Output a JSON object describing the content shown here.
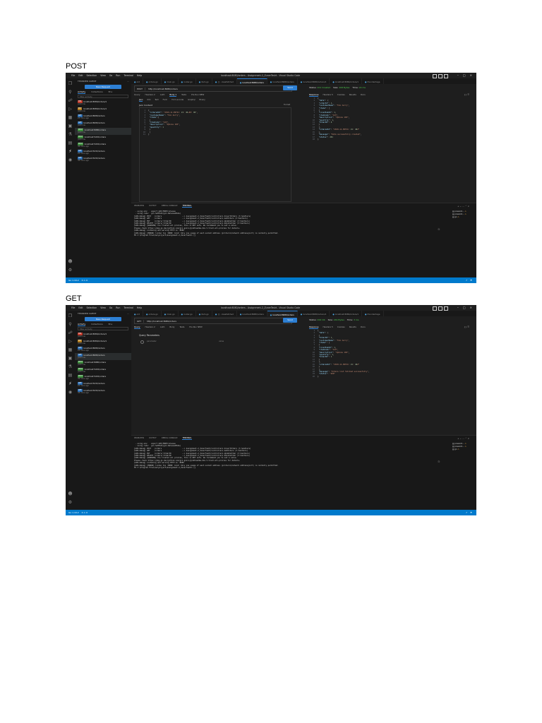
{
  "sections": [
    {
      "label": "POST",
      "titlebar": {
        "menus": [
          "File",
          "Edit",
          "Selection",
          "View",
          "Go",
          "Run",
          "Terminal",
          "Help"
        ],
        "title": "localhost:8080/orders - Assignment-2_ZunerTesht - Visual Studio Code"
      },
      "sidebar": {
        "header": "THUNDER CLIENT",
        "new_request": "New Request",
        "tabs": [
          "Activity",
          "Collections",
          "Env"
        ],
        "filter_placeholder": "filter activity",
        "history": [
          {
            "method": "DEL",
            "url": "localhost:8080/orders/1",
            "ago": "just now"
          },
          {
            "method": "PUT",
            "url": "localhost:8080/orders/1",
            "ago": "just now"
          },
          {
            "method": "GET",
            "url": "localhost:8080/orders",
            "ago": "23 mins ago"
          },
          {
            "method": "GET",
            "url": "localhost:8080/orders",
            "ago": "just now"
          },
          {
            "method": "POST",
            "url": "localhost:8080/orders",
            "ago": "just now",
            "selected": true
          },
          {
            "method": "POST",
            "url": "localhost:5432/orders",
            "ago": "just now"
          },
          {
            "method": "POST",
            "url": "localhost:5432/orders",
            "ago": "36 mins ago"
          },
          {
            "method": "GET",
            "url": "localhost:5432/orders",
            "ago": "24 mins ago"
          },
          {
            "method": "GET",
            "url": "localhost:5432/orders",
            "ago": "38 mins ago"
          }
        ]
      },
      "tabs": [
        {
          "label": "ord",
          "active": false
        },
        {
          "label": "orders.go",
          "active": false
        },
        {
          "label": "main.go",
          "active": false
        },
        {
          "label": "router.go",
          "active": false
        },
        {
          "label": "item.go",
          "active": false
        },
        {
          "label": "{} .rowsfetched",
          "active": false
        },
        {
          "label": "localhost:8080/orders",
          "active": true
        },
        {
          "label": "localhost:8080/orders",
          "active": false
        },
        {
          "label": "localhost:8080/orders/1",
          "active": false
        },
        {
          "label": "localhost:8080/orders/1",
          "active": false
        },
        {
          "label": "thunderdage",
          "active": false
        }
      ],
      "request": {
        "method": "POST",
        "url": "http://localhost:8080/orders",
        "send": "Send",
        "tabs": [
          "Query",
          "Headers 2",
          "Auth",
          "Body 1",
          "Tests",
          "Pre Run NEW"
        ],
        "active_tab": "Body 1",
        "body_tabs": [
          "Json",
          "Xml",
          "Text",
          "Form",
          "Form-encode",
          "Graphql",
          "Binary"
        ],
        "active_body_tab": "Json",
        "json_label": "Json Content",
        "format": "Format",
        "code": [
          {
            "n": "1",
            "t": "{"
          },
          {
            "n": "2",
            "t": "  \"orderedAt\":\"2019-11-09T21:21:46+00:00\","
          },
          {
            "n": "3",
            "t": "  \"customerName\":\"Tom Jerry\","
          },
          {
            "n": "4",
            "t": "  \"items\":["
          },
          {
            "n": "5",
            "t": "    {"
          },
          {
            "n": "6",
            "t": "      \"itemCode\":\"123\","
          },
          {
            "n": "7",
            "t": "      \"description\":\"Iphone 10X\","
          },
          {
            "n": "8",
            "t": "      \"quantity\":1"
          },
          {
            "n": "9",
            "t": "    }"
          },
          {
            "n": "10",
            "t": "  ]"
          },
          {
            "n": "11",
            "t": "}"
          }
        ]
      },
      "response": {
        "status_label": "Status:",
        "status": "201 Created",
        "size_label": "Size:",
        "size": "208 Bytes",
        "time_label": "Time:",
        "time": "22 ms",
        "tabs": [
          "Response",
          "Headers 5",
          "Cookies",
          "Results",
          "Docs"
        ],
        "code": [
          {
            "n": "1",
            "t": "{"
          },
          {
            "n": "2",
            "t": "  \"data\": {"
          },
          {
            "n": "3",
            "t": "    \"orderId\": 1,"
          },
          {
            "n": "4",
            "t": "    \"customerName\": \"Tom Jerry\","
          },
          {
            "n": "5",
            "t": "    \"items\": ["
          },
          {
            "n": "6",
            "t": "      {"
          },
          {
            "n": "7",
            "t": "        \"lineItemId\": 1,"
          },
          {
            "n": "8",
            "t": "        \"itemCode\": \"123\","
          },
          {
            "n": "9",
            "t": "        \"description\": \"Iphone 10X\","
          },
          {
            "n": "10",
            "t": "        \"quantity\": 1,"
          },
          {
            "n": "11",
            "t": "        \"OrderID\": 0"
          },
          {
            "n": "12",
            "t": "      }"
          },
          {
            "n": "13",
            "t": "    ],"
          },
          {
            "n": "14",
            "t": "    \"orderedAt\": \"2019-11-09T21:21:46Z\""
          },
          {
            "n": "15",
            "t": "  },"
          },
          {
            "n": "16",
            "t": "  \"message\": \"Data successfully created\","
          },
          {
            "n": "17",
            "t": "  \"status\": 201"
          },
          {
            "n": "18",
            "t": "}"
          }
        ]
      },
      "panel": {
        "tabs": [
          "PROBLEMS",
          "OUTPUT",
          "DEBUG CONSOLE",
          "TERMINAL"
        ],
        "active": "TERMINAL",
        "terminal": [
          " - using env:   export GIN_MODE=release",
          " - using code:  gin.SetMode(gin.ReleaseMode)",
          "",
          "[GIN-debug] POST   /orders                   --> Assignment-2_ZunerTesht/controllers.InsertOrders (3 handlers)",
          "[GIN-debug] GET    /orders                   --> Assignment-2_ZunerTesht/controllers.GetOrders (3 handlers)",
          "[GIN-debug] PUT    /orders/:OrderID          --> Assignment-2_ZunerTesht/controllers.UpdateOrder (3 handlers)",
          "[GIN-debug] DELETE /orders/:OrderID          --> Assignment-2_ZunerTesht/controllers.DeleteOrder (3 handlers)",
          "[GIN-debug] [WARNING] You trusted all proxies, this is NOT safe. We recommend you to set a value.",
          "Please check https://pkg.go.dev/github.com/gin-gonic/gin#readme-don-t-trust-all-proxies for details.",
          "[GIN-debug] Listening and serving HTTP on :8080",
          "[GIN-debug] [ERROR] listen tcp :8080: bind: Only one usage of each socket address (protocol/network address/port) is normally permitted.",
          "PS C:\\Program Files\\Go\\project\\Assignment-2_ZunerTesht> []"
        ],
        "terminals": [
          "powersh...",
          "powersh...",
          "go"
        ]
      },
      "statusbar": {
        "left": [
          "Go 1.19.2",
          "0 ⚠ 0"
        ],
        "right": [
          "↗",
          "⚑"
        ]
      }
    },
    {
      "label": "GET",
      "titlebar": {
        "menus": [
          "File",
          "Edit",
          "Selection",
          "View",
          "Go",
          "Run",
          "Terminal",
          "Help"
        ],
        "title": "localhost:8080/orders - Assignment-2_ZunerTesht - Visual Studio Code"
      },
      "sidebar": {
        "header": "THUNDER CLIENT",
        "new_request": "New Request",
        "tabs": [
          "Activity",
          "Collections",
          "Env"
        ],
        "filter_placeholder": "filter activity",
        "history": [
          {
            "method": "DEL",
            "url": "localhost:8080/orders/1",
            "ago": "just now"
          },
          {
            "method": "PUT",
            "url": "localhost:8080/orders/1",
            "ago": "just now"
          },
          {
            "method": "GET",
            "url": "localhost:8080/orders",
            "ago": "23 mins ago"
          },
          {
            "method": "GET",
            "url": "localhost:8080/orders",
            "ago": "just now",
            "selected": true
          },
          {
            "method": "POST",
            "url": "localhost:8080/orders",
            "ago": "just now"
          },
          {
            "method": "POST",
            "url": "localhost:5432/orders",
            "ago": "just now"
          },
          {
            "method": "POST",
            "url": "localhost:5432/orders",
            "ago": "36 mins ago"
          },
          {
            "method": "GET",
            "url": "localhost:5432/orders",
            "ago": "24 mins ago"
          },
          {
            "method": "GET",
            "url": "localhost:5432/orders",
            "ago": "38 mins ago"
          }
        ]
      },
      "tabs": [
        {
          "label": "ord",
          "active": false
        },
        {
          "label": "orders.go",
          "active": false
        },
        {
          "label": "main.go",
          "active": false
        },
        {
          "label": "router.go",
          "active": false
        },
        {
          "label": "item.go",
          "active": false
        },
        {
          "label": "{} .rowsfetched",
          "active": false
        },
        {
          "label": "localhost:8080/orders",
          "active": false
        },
        {
          "label": "localhost:8080/orders",
          "active": true
        },
        {
          "label": "localhost:8080/orders/1",
          "active": false
        },
        {
          "label": "localhost:8080/orders/1",
          "active": false
        },
        {
          "label": "thunderdage",
          "active": false
        }
      ],
      "request": {
        "method": "GET",
        "url": "http://localhost:8080/orders",
        "send": "Send",
        "tabs": [
          "Query",
          "Headers 2",
          "Auth",
          "Body",
          "Tests",
          "Pre Run NEW"
        ],
        "active_tab": "Query",
        "qp_label": "Query Parameters",
        "qp_param": "parameter",
        "qp_value": "value"
      },
      "response": {
        "status_label": "Status:",
        "status": "200 OK",
        "size_label": "Size:",
        "size": "249 Bytes",
        "time_label": "Time:",
        "time": "3 ms",
        "tabs": [
          "Response",
          "Headers 5",
          "Cookies",
          "Results",
          "Docs"
        ],
        "code": [
          {
            "n": "1",
            "t": "{"
          },
          {
            "n": "2",
            "t": "  \"data\": ["
          },
          {
            "n": "3",
            "t": "    {"
          },
          {
            "n": "4",
            "t": "      \"OrderID\": 1,"
          },
          {
            "n": "5",
            "t": "      \"customerName\": \"Tom Jerry\","
          },
          {
            "n": "6",
            "t": "      \"items\": ["
          },
          {
            "n": "7",
            "t": "        {"
          },
          {
            "n": "8",
            "t": "          \"lineItemId\": 1,"
          },
          {
            "n": "9",
            "t": "          \"itemCode\": \"123\","
          },
          {
            "n": "10",
            "t": "          \"description\": \"Iphone 10X\","
          },
          {
            "n": "11",
            "t": "          \"quantity\": 1,"
          },
          {
            "n": "12",
            "t": "          \"OrderID\": 1"
          },
          {
            "n": "13",
            "t": "        }"
          },
          {
            "n": "14",
            "t": "      ],"
          },
          {
            "n": "15",
            "t": "      \"orderedAt\": \"2019-11-09T21:21:46Z\""
          },
          {
            "n": "16",
            "t": "    }"
          },
          {
            "n": "17",
            "t": "  ],"
          },
          {
            "n": "18",
            "t": "  \"message\": \"Orders list fetched successfully\","
          },
          {
            "n": "19",
            "t": "  \"status\": \"200\""
          },
          {
            "n": "20",
            "t": "}"
          }
        ]
      },
      "panel": {
        "tabs": [
          "PROBLEMS",
          "OUTPUT",
          "DEBUG CONSOLE",
          "TERMINAL"
        ],
        "active": "TERMINAL",
        "terminal": [
          " - using env:   export GIN_MODE=release",
          " - using code:  gin.SetMode(gin.ReleaseMode)",
          "",
          "[GIN-debug] POST   /orders                   --> Assignment-2_ZunerTesht/controllers.InsertOrders (3 handlers)",
          "[GIN-debug] GET    /orders                   --> Assignment-2_ZunerTesht/controllers.GetOrders (3 handlers)",
          "[GIN-debug] PUT    /orders/:OrderID          --> Assignment-2_ZunerTesht/controllers.UpdateOrder (3 handlers)",
          "[GIN-debug] DELETE /orders/:OrderID          --> Assignment-2_ZunerTesht/controllers.DeleteOrder (3 handlers)",
          "[GIN-debug] [WARNING] You trusted all proxies, this is NOT safe. We recommend you to set a value.",
          "Please check https://pkg.go.dev/github.com/gin-gonic/gin#readme-don-t-trust-all-proxies for details.",
          "[GIN-debug] Listening and serving HTTP on :8080",
          "[GIN-debug] [ERROR] listen tcp :8080: bind: Only one usage of each socket address (protocol/network address/port) is normally permitted.",
          "PS C:\\Program Files\\Go\\project\\Assignment-2_ZunerTesht> []"
        ],
        "terminals": [
          "powersh...",
          "powersh...",
          "go"
        ]
      },
      "statusbar": {
        "left": [
          "Go 1.19.2",
          "0 ⚠ 0"
        ],
        "right": [
          "↗",
          "⚑"
        ]
      }
    }
  ]
}
